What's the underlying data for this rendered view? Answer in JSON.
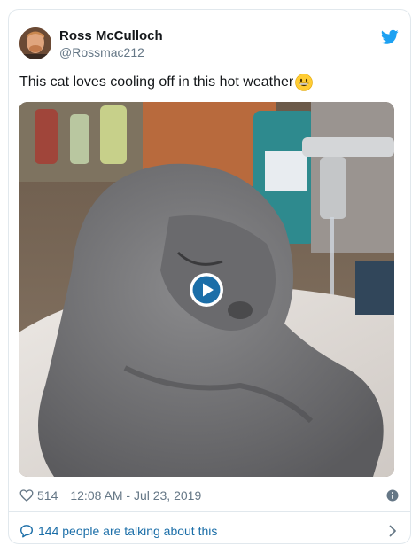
{
  "tweet": {
    "author_name": "Ross McCulloch",
    "author_handle": "@Rossmac212",
    "text": "This cat loves cooling off in this hot weather",
    "emoji": "grinning-face-emoji",
    "likes": "514",
    "timestamp": "12:08 AM - Jul 23, 2019",
    "conversation": "144 people are talking about this"
  },
  "colors": {
    "twitter_blue": "#1da1f2",
    "link_blue": "#1b6ea8",
    "text_primary": "#14171a",
    "text_secondary": "#657786",
    "border": "#e1e8ed"
  },
  "icons": {
    "twitter": "twitter-bird-icon",
    "like": "heart-icon",
    "info": "info-icon",
    "reply": "speech-bubble-icon",
    "more": "chevron-right-icon",
    "play": "play-icon"
  }
}
